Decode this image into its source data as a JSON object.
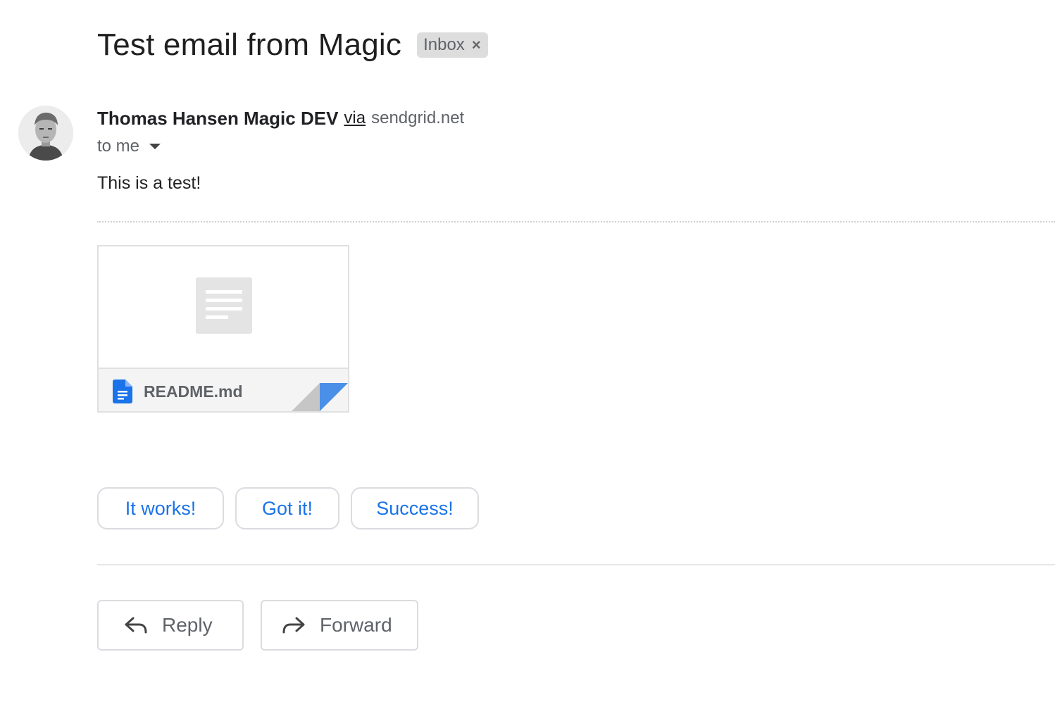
{
  "message": {
    "subject": "Test email from Magic",
    "label": "Inbox",
    "label_remove": "×",
    "sender_name": "Thomas Hansen Magic DEV",
    "via": "via",
    "via_domain": "sendgrid.net",
    "recipient": "to me",
    "body": "This is a test!"
  },
  "attachment": {
    "file_name": "README.md",
    "icon": "doc-file-icon"
  },
  "smart_replies": [
    "It works!",
    "Got it!",
    "Success!"
  ],
  "actions": {
    "reply_label": "Reply",
    "forward_label": "Forward"
  },
  "colors": {
    "accent": "#1a73e8",
    "chip_bg": "#dddddd",
    "muted_text": "#5f6368"
  }
}
